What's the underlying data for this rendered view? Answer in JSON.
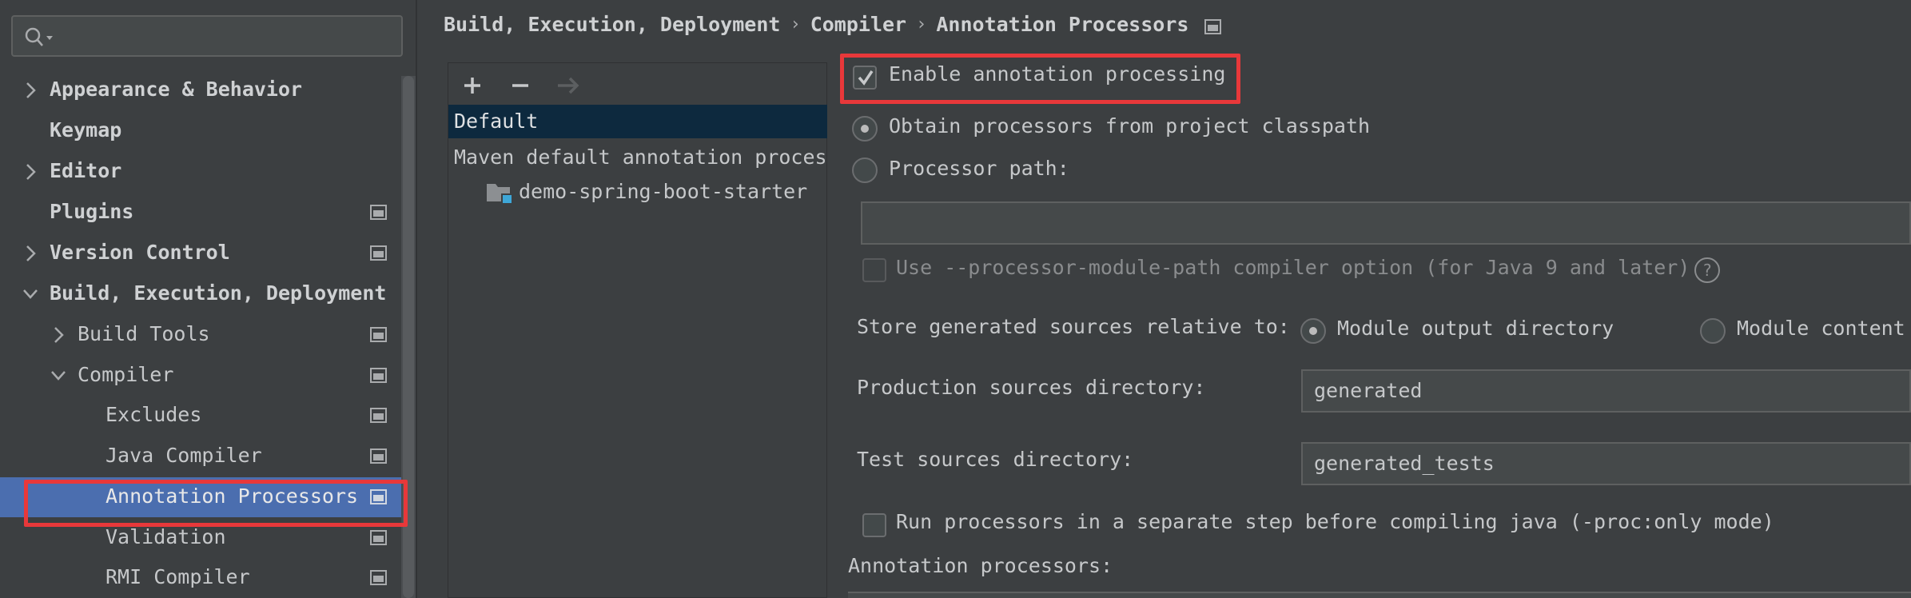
{
  "breadcrumb": {
    "items": [
      "Build, Execution, Deployment",
      "Compiler",
      "Annotation Processors"
    ],
    "separator": "›"
  },
  "sidebar": {
    "items": [
      {
        "label": "Appearance & Behavior",
        "arrow": "right",
        "bold": true
      },
      {
        "label": "Keymap",
        "bold": true
      },
      {
        "label": "Editor",
        "arrow": "right",
        "bold": true
      },
      {
        "label": "Plugins",
        "bold": true,
        "icon": "project-icon"
      },
      {
        "label": "Version Control",
        "arrow": "right",
        "bold": true,
        "icon": "project-icon"
      },
      {
        "label": "Build, Execution, Deployment",
        "arrow": "down",
        "bold": true
      },
      {
        "label": "Build Tools",
        "arrow": "right",
        "icon": "project-icon"
      },
      {
        "label": "Compiler",
        "arrow": "down",
        "icon": "project-icon"
      },
      {
        "label": "Excludes",
        "icon": "project-icon"
      },
      {
        "label": "Java Compiler",
        "icon": "project-icon"
      },
      {
        "label": "Annotation Processors",
        "icon": "project-icon",
        "selected": true
      },
      {
        "label": "Validation",
        "icon": "project-icon"
      },
      {
        "label": "RMI Compiler",
        "icon": "project-icon"
      }
    ]
  },
  "profiles": {
    "toolbar": {
      "add": "+",
      "remove": "−",
      "move": "→"
    },
    "items": [
      {
        "label": "Default",
        "selected": true
      },
      {
        "label": "Maven default annotation proces"
      },
      {
        "label": "demo-spring-boot-starter",
        "icon": "module-folder-icon"
      }
    ]
  },
  "settings": {
    "enable_label": "Enable annotation processing",
    "enable_checked": true,
    "obtain_from_classpath_label": "Obtain processors from project classpath",
    "obtain_from_classpath_selected": true,
    "processor_path_label": "Processor path:",
    "processor_path_value": "",
    "module_path_label": "Use --processor-module-path compiler option (for Java 9 and later)",
    "help_glyph": "?",
    "store_relative_label": "Store generated sources relative to:",
    "module_output_label": "Module output directory",
    "module_output_selected": true,
    "module_content_label": "Module content",
    "production_dir_label": "Production sources directory:",
    "production_dir_value": "generated",
    "test_dir_label": "Test sources directory:",
    "test_dir_value": "generated_tests",
    "run_separate_label": "Run processors in a separate step before compiling java (-proc:only mode)",
    "run_separate_checked": false,
    "annotation_processors_label": "Annotation processors:"
  },
  "colors": {
    "background": "#3c3f41",
    "selection": "#4b6eaf",
    "list_selection": "#0d293e",
    "highlight": "#e8383a"
  }
}
